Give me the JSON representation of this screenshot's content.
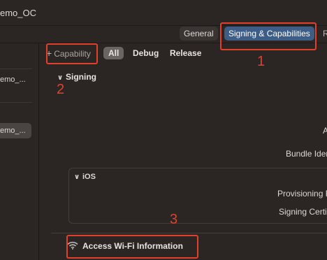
{
  "window": {
    "title": "emo_OC"
  },
  "tabs": [
    {
      "label": "General"
    },
    {
      "label": "Signing & Capabilities"
    },
    {
      "label": "R"
    }
  ],
  "sidebar": {
    "items": [
      {
        "label": "emo_..."
      },
      {
        "label": "emo_..."
      }
    ]
  },
  "filter": {
    "capability_label": "Capability",
    "options": [
      {
        "label": "All"
      },
      {
        "label": "Debug"
      },
      {
        "label": "Release"
      }
    ]
  },
  "signing": {
    "section_title": "Signing",
    "rows": [
      {
        "label": "A"
      },
      {
        "label": "Bundle Ider"
      }
    ]
  },
  "ios": {
    "title": "iOS",
    "rows": [
      {
        "label": "Provisioning P"
      },
      {
        "label": "Signing Certi"
      }
    ]
  },
  "capability": {
    "label": "Access Wi-Fi Information",
    "icon": "wifi-icon"
  },
  "annotations": [
    {
      "number": "1"
    },
    {
      "number": "2"
    },
    {
      "number": "3"
    }
  ],
  "colors": {
    "background": "#2b2624",
    "selected_tab": "#3e5d86",
    "annotation_red": "#e2402c"
  }
}
